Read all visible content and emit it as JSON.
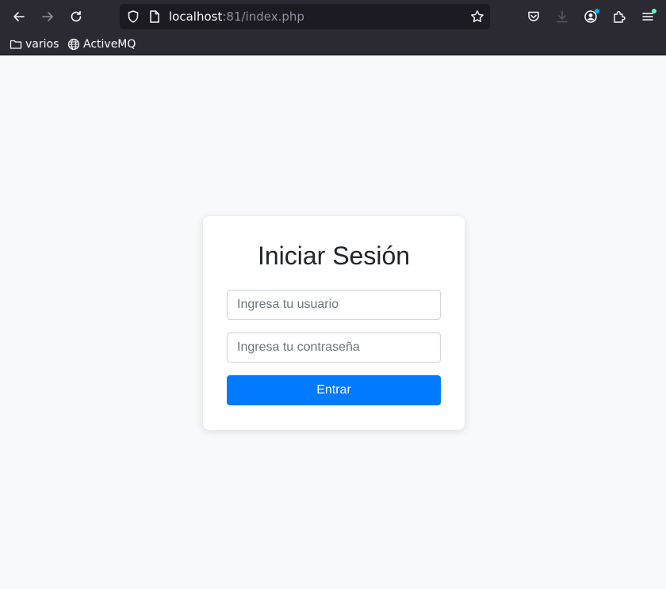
{
  "browser": {
    "url_host": "localhost",
    "url_rest": ":81/index.php",
    "icons": [
      "back-icon",
      "forward-icon",
      "reload-icon",
      "shield-icon",
      "page-icon",
      "star-icon",
      "pocket-icon",
      "download-icon",
      "account-icon",
      "extensions-icon",
      "menu-icon"
    ],
    "accent_dot": "#54ffbd"
  },
  "bookmarks": [
    {
      "label": "varios",
      "icon": "folder-icon"
    },
    {
      "label": "ActiveMQ",
      "icon": "globe-icon"
    }
  ],
  "login": {
    "title": "Iniciar Sesión",
    "username_placeholder": "Ingresa tu usuario",
    "password_placeholder": "Ingresa tu contraseña",
    "submit_label": "Entrar"
  },
  "colors": {
    "primary": "#007bff",
    "background": "#f8f9fa"
  }
}
